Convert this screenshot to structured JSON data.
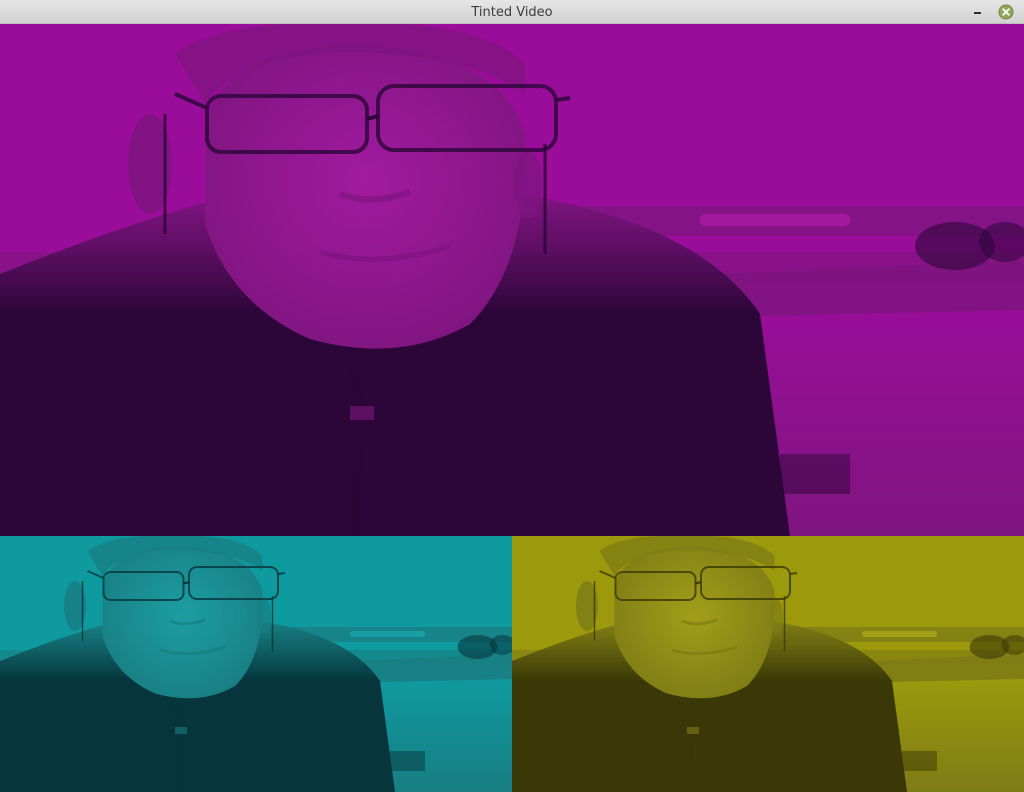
{
  "window": {
    "title": "Tinted Video",
    "controls": {
      "minimize_icon": "minimize-icon",
      "close_icon": "close-icon"
    }
  },
  "frames": [
    {
      "id": "magenta",
      "tint": "#9a0d9a",
      "shadow": "#2c0638",
      "skin": "#a21aa0",
      "window": "#a51ba3",
      "sill": "#7e157f"
    },
    {
      "id": "cyan",
      "tint": "#0f9aa0",
      "shadow": "#06353c",
      "skin": "#1c9ea2",
      "window": "#1aa2a6",
      "sill": "#187e82"
    },
    {
      "id": "yellow",
      "tint": "#9c9a0c",
      "shadow": "#3a3806",
      "skin": "#a29e1a",
      "window": "#a5a21a",
      "sill": "#7e7c15"
    }
  ],
  "colors": {
    "close_button": "#8fa85a",
    "titlebar": "#dcdcdc"
  }
}
